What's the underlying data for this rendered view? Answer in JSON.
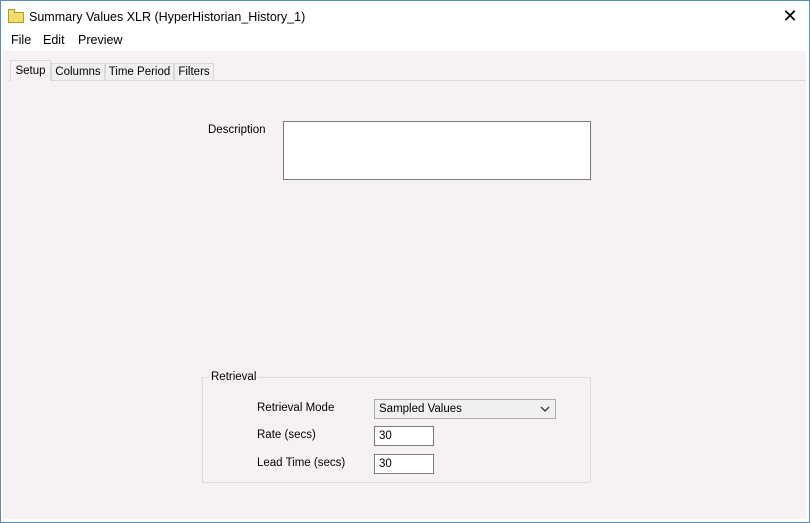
{
  "window": {
    "title": "Summary Values XLR (HyperHistorian_History_1)",
    "close_glyph": "✕"
  },
  "menu": {
    "items": [
      "File",
      "Edit",
      "Preview"
    ]
  },
  "tabs": [
    {
      "label": "Setup",
      "active": true
    },
    {
      "label": "Columns",
      "active": false
    },
    {
      "label": "Time Period",
      "active": false
    },
    {
      "label": "Filters",
      "active": false
    }
  ],
  "setup": {
    "description_label": "Description",
    "description_value": "",
    "retrieval": {
      "group_label": "Retrieval",
      "mode_label": "Retrieval Mode",
      "mode_value": "Sampled Values",
      "rate_label": "Rate (secs)",
      "rate_value": "30",
      "lead_time_label": "Lead Time (secs)",
      "lead_time_value": "30"
    }
  },
  "icons": {
    "window_icon": "folder-icon",
    "dropdown": "chevron-down-icon"
  }
}
